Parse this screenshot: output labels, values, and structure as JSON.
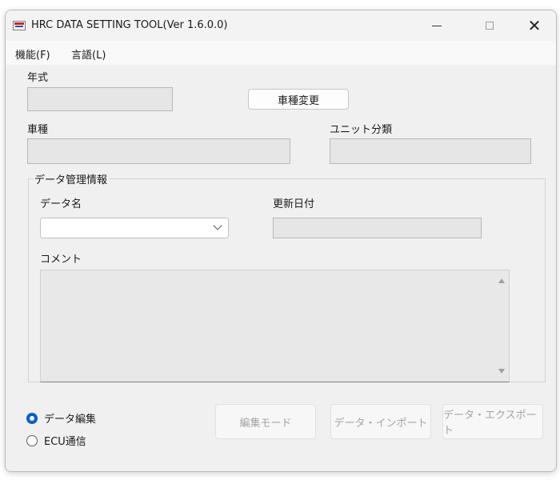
{
  "window": {
    "title": "HRC DATA SETTING TOOL(Ver 1.6.0.0)",
    "accent": "#0a5fc4"
  },
  "menu": {
    "items": [
      "機能(F)",
      "言語(L)"
    ]
  },
  "form": {
    "year_label": "年式",
    "year_value": "",
    "change_model_button": "車種変更",
    "model_label": "車種",
    "model_value": "",
    "unit_class_label": "ユニット分類",
    "unit_class_value": "",
    "group_title": "データ管理情報",
    "data_name_label": "データ名",
    "data_name_value": "",
    "updated_label": "更新日付",
    "updated_value": "",
    "comment_label": "コメント",
    "comment_value": ""
  },
  "mode": {
    "options": [
      {
        "label": "データ編集",
        "checked": true
      },
      {
        "label": "ECU通信",
        "checked": false
      }
    ]
  },
  "actions": {
    "edit_mode": "編集モード",
    "data_import": "データ・インポート",
    "data_export": "データ・エクスポート"
  }
}
